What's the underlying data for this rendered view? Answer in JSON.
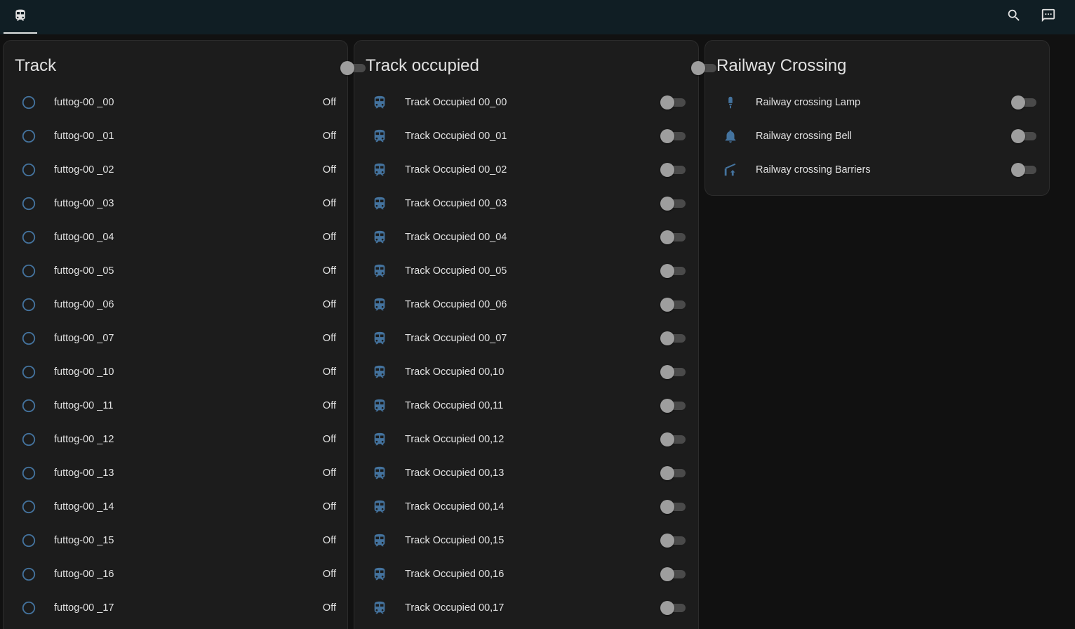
{
  "colors": {
    "topbar": "#101e24",
    "background": "#111111",
    "card": "#1c1c1c",
    "icon_blue": "#44739e",
    "toggle_off": "#9e9e9e"
  },
  "topbar": {
    "tab_icon": "train-icon",
    "actions": [
      {
        "icon": "search-icon"
      },
      {
        "icon": "assist-chat-icon"
      }
    ]
  },
  "track_card": {
    "title": "Track",
    "rows": [
      {
        "label": "futtog-00 _00",
        "state": "Off"
      },
      {
        "label": "futtog-00 _01",
        "state": "Off"
      },
      {
        "label": "futtog-00 _02",
        "state": "Off"
      },
      {
        "label": "futtog-00 _03",
        "state": "Off"
      },
      {
        "label": "futtog-00 _04",
        "state": "Off"
      },
      {
        "label": "futtog-00 _05",
        "state": "Off"
      },
      {
        "label": "futtog-00 _06",
        "state": "Off"
      },
      {
        "label": "futtog-00 _07",
        "state": "Off"
      },
      {
        "label": "futtog-00 _10",
        "state": "Off"
      },
      {
        "label": "futtog-00 _11",
        "state": "Off"
      },
      {
        "label": "futtog-00 _12",
        "state": "Off"
      },
      {
        "label": "futtog-00 _13",
        "state": "Off"
      },
      {
        "label": "futtog-00 _14",
        "state": "Off"
      },
      {
        "label": "futtog-00 _15",
        "state": "Off"
      },
      {
        "label": "futtog-00 _16",
        "state": "Off"
      },
      {
        "label": "futtog-00 _17",
        "state": "Off"
      }
    ]
  },
  "occupied_card": {
    "title": "Track occupied",
    "header_toggle_on": false,
    "rows": [
      {
        "label": "Track Occupied 00_00",
        "on": false
      },
      {
        "label": "Track Occupied 00_01",
        "on": false
      },
      {
        "label": "Track Occupied 00_02",
        "on": false
      },
      {
        "label": "Track Occupied 00_03",
        "on": false
      },
      {
        "label": "Track Occupied 00_04",
        "on": false
      },
      {
        "label": "Track Occupied 00_05",
        "on": false
      },
      {
        "label": "Track Occupied 00_06",
        "on": false
      },
      {
        "label": "Track Occupied 00_07",
        "on": false
      },
      {
        "label": "Track Occupied 00,10",
        "on": false
      },
      {
        "label": "Track Occupied 00,11",
        "on": false
      },
      {
        "label": "Track Occupied 00,12",
        "on": false
      },
      {
        "label": "Track Occupied 00,13",
        "on": false
      },
      {
        "label": "Track Occupied 00,14",
        "on": false
      },
      {
        "label": "Track Occupied 00,15",
        "on": false
      },
      {
        "label": "Track Occupied 00,16",
        "on": false
      },
      {
        "label": "Track Occupied 00,17",
        "on": false
      }
    ]
  },
  "crossing_card": {
    "title": "Railway Crossing",
    "header_toggle_on": false,
    "rows": [
      {
        "label": "Railway crossing Lamp",
        "icon": "lamp-icon",
        "on": false
      },
      {
        "label": "Railway crossing Bell",
        "icon": "bell-icon",
        "on": false
      },
      {
        "label": "Railway crossing Barriers",
        "icon": "boom-gate-icon",
        "on": false
      }
    ]
  }
}
